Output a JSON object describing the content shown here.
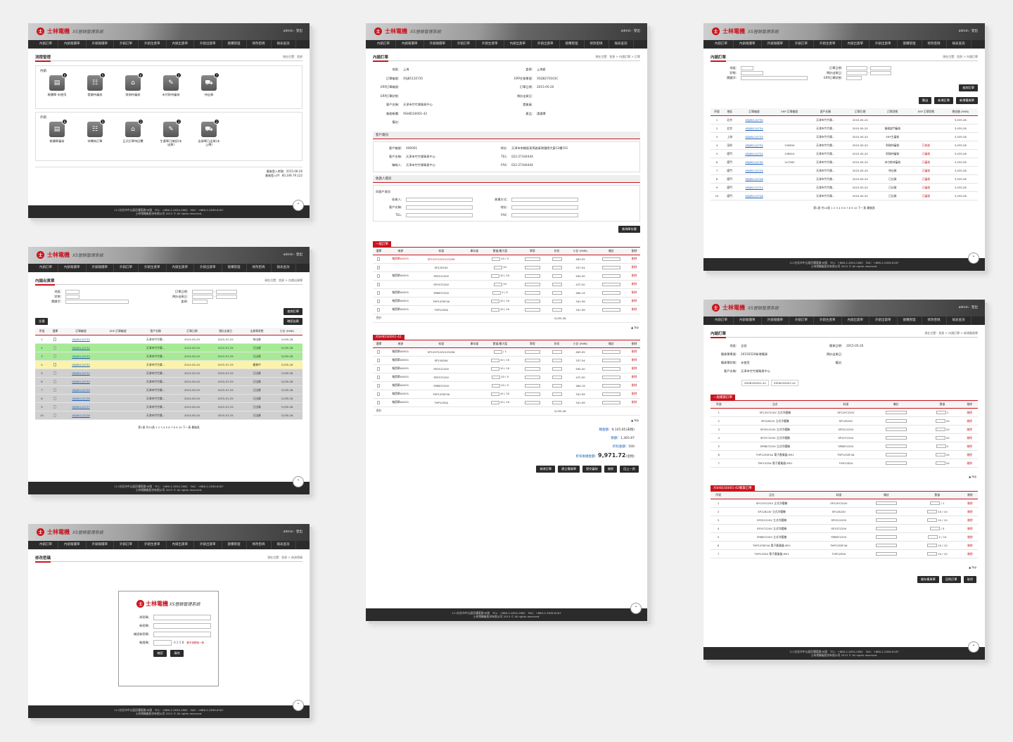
{
  "brand": {
    "logo_mark": "士",
    "logo": "士林電機",
    "system": "XS營銷管理系統",
    "user": "admin · 登出"
  },
  "nav": [
    "內銷訂單",
    "內銷報價單",
    "外銷報價單",
    "外銷訂單",
    "外銷生產單",
    "內銷出貨單",
    "外銷出貨單",
    "搶購管理",
    "修改密碼",
    "報表查詢"
  ],
  "footer": {
    "line1": "111台北市中山區民權東路36號　TEL：+886-2-2834-2662　FAX：+886-2-2836-6187",
    "line2": "士林電機廠股份有限公司 2015 © All rights reserved."
  },
  "p1": {
    "title": "流程管理",
    "crumb": "現在位置：首頁",
    "sec1": "內銷",
    "sec2": "外銷",
    "icons1": [
      {
        "label": "報價單-未使用",
        "badge": "6"
      },
      {
        "label": "營業待審核",
        "badge": "5"
      },
      {
        "label": "財務待審核",
        "badge": "6"
      },
      {
        "label": "未付款待審核",
        "badge": "2"
      },
      {
        "label": "待出貨",
        "badge": "7"
      }
    ],
    "icons2": [
      {
        "label": "報價單審核",
        "badge": "6"
      },
      {
        "label": "待轉為訂單",
        "badge": "5"
      },
      {
        "label": "正式訂單待回覆",
        "badge": "3"
      },
      {
        "label": "生產單已確認(未出貨)",
        "badge": "3"
      },
      {
        "label": "出貨單已出貨(未上傳)",
        "badge": "2"
      }
    ],
    "date": "最後登入時間：2015-06-26",
    "ip": "最後登入IP：60.249.79.122"
  },
  "p2": {
    "title": "內銷出貨單",
    "crumb": "現在位置：首頁 > 內銷出貨單",
    "search_btn": "查詢訂單",
    "all_btn": "全選",
    "confirm_btn": "確認出貨",
    "headers": [
      "序號",
      "選擇",
      "訂單編號",
      "ERP 訂單編號",
      "客戶名稱",
      "訂單日期",
      "預計出貨日",
      "出貨單狀態",
      "小計 (RMB)"
    ],
    "rows": [
      [
        "1",
        "XSJ85110735",
        "天津市竹竹樂...",
        "2015-05-20",
        "2015-07-25",
        "待出貨",
        "3,035.28"
      ],
      [
        "2",
        "XSJ85110734",
        "天津市竹竹樂...",
        "2015-05-20",
        "2015-07-25",
        "已出貨",
        "3,035.28"
      ],
      [
        "3",
        "XSJ85110733",
        "天津市竹竹樂...",
        "2015-05-20",
        "2015-07-25",
        "已出貨",
        "3,035.28"
      ],
      [
        "4",
        "XSJ85110732",
        "天津市竹竹樂...",
        "2015-05-20",
        "2015-07-25",
        "備貨中",
        "3,035.28"
      ],
      [
        "5",
        "XSJ85110731",
        "天津市竹竹樂...",
        "2015-05-20",
        "2015-07-25",
        "已出貨",
        "3,035.28"
      ],
      [
        "6",
        "XSJ85110730",
        "天津市竹竹樂...",
        "2015-05-20",
        "2015-07-25",
        "已出貨",
        "3,035.28"
      ],
      [
        "7",
        "XSJ85110729",
        "天津市竹竹樂...",
        "2015-05-20",
        "2015-07-25",
        "已出貨",
        "3,035.28"
      ],
      [
        "8",
        "XSJ85110728",
        "天津市竹竹樂...",
        "2015-05-20",
        "2015-07-25",
        "已出貨",
        "3,035.28"
      ],
      [
        "9",
        "XSJ85110727",
        "天津市竹竹樂...",
        "2015-05-20",
        "2015-07-25",
        "已出貨",
        "3,035.28"
      ],
      [
        "10",
        "XSJ85110726",
        "天津市竹竹樂...",
        "2015-05-20",
        "2015-07-25",
        "已出貨",
        "3,035.28"
      ]
    ],
    "pager": "第1頁 共10頁 1 2 3 4 5 6 7 8 9 10 下一頁 最後頁"
  },
  "p3": {
    "title": "修改密碼",
    "crumb": "現在位置：首頁 > 修改密碼",
    "fields": [
      "原密碼：",
      "新密碼：",
      "確認新密碼：",
      "驗證碼："
    ],
    "captcha": "A 2 5 B",
    "refresh": "看不清楚換一張",
    "ok": "確認",
    "clear": "清除"
  },
  "p4": {
    "title": "內銷訂單",
    "crumb": "現在位置：首頁 > 內銷訂單 > 訂單",
    "info": [
      [
        "地區：",
        "上海"
      ],
      [
        "訂單編號：",
        "XSJ85110735"
      ],
      [
        "ERP訂單編號：",
        ""
      ],
      [
        "ERP訂單狀態：",
        ""
      ],
      [
        "客戶名稱：",
        "天津市竹竹樂貿易中心"
      ],
      [
        "業務報價：",
        "XSH81S0001-42"
      ],
      [
        "備註：",
        ""
      ]
    ],
    "info2": [
      [
        "倉庫：",
        "上海倉"
      ],
      [
        "ERP交貨單號：",
        "XSQ8270103C"
      ],
      [
        "訂單日期：",
        "2015-05-20"
      ],
      [
        "預計出貨日：",
        ""
      ],
      [
        "營業員：",
        ""
      ],
      [
        "產品：",
        "請選擇"
      ]
    ],
    "cust_title": "客戶資訊",
    "cust": [
      [
        "客戶編號：",
        "A00001"
      ],
      [
        "客戶名稱：",
        "天津市竹竹樂貿易中心"
      ],
      [
        "聯絡人：",
        "天津市竹竹樂貿易中心"
      ]
    ],
    "cust2": [
      [
        "地址：",
        "天津市南開區東馬路泰興國際大廈12樓101"
      ],
      [
        "TEL：",
        "022-27344444"
      ],
      [
        "FAX：",
        "022-27344444"
      ]
    ],
    "recv_title": "收貨人資訊",
    "recv_chk": "同客戶資訊",
    "recv": [
      "收貨人：",
      "客戶名稱：",
      "TEL："
    ],
    "recv2": [
      "貨運方式：",
      "地址：",
      "FAX："
    ],
    "btn_stock": "查詢庫存量",
    "sec1": "一般訂單",
    "sec2": "XSH81S0001-42",
    "headers": [
      "選擇",
      "來源",
      "料號",
      "庫存量",
      "數量/最大值",
      "單價",
      "折扣",
      "小計 (RMB)",
      "備註",
      "刪除"
    ],
    "rows1": [
      [
        "報價單AX001",
        "SP1297220V123456",
        "10 / 3",
        "463.0509",
        "13.1234",
        "463.05",
        "刪除"
      ],
      [
        "",
        "SP12924V",
        "10",
        "337.7545",
        "",
        "337.54",
        "刪除"
      ],
      [
        "報價單AX001",
        "SP2S1220V",
        "10 / 10",
        "59.4009",
        "",
        "594.00",
        "刪除"
      ],
      [
        "",
        "SP1S7220V",
        "10",
        "94.6009",
        "",
        "472.50",
        "刪除"
      ],
      [
        "報價單AX001",
        "SP8B7220V",
        "5 / 5",
        "242.0964",
        "",
        "484.19",
        "刪除"
      ],
      [
        "報價單AX001",
        "THP12S5F4A",
        "10 / 10",
        "34.1991",
        "",
        "341.99",
        "刪除"
      ],
      [
        "報價單AX001",
        "THP12S5A",
        "10 / 10",
        "34.1991",
        "",
        "341.99",
        "刪除"
      ]
    ],
    "rows2": [
      [
        "報價單AX001",
        "SP1297220V123456",
        "/ 1",
        "463.0509",
        "13.1234",
        "463.05",
        "刪除"
      ],
      [
        "報價單AX001",
        "SP1262AV",
        "10 / 10",
        "33.7545",
        "",
        "337.54",
        "刪除"
      ],
      [
        "報價單AX001",
        "SP2S1220V",
        "10 / 10",
        "59.4009",
        "",
        "594.00",
        "刪除"
      ],
      [
        "報價單AX001",
        "SP2S7220V",
        "10 / 5",
        "94.6009",
        "",
        "472.50",
        "刪除"
      ],
      [
        "報價單AX001",
        "SP8B7220V",
        "10 / 5",
        "242.0964",
        "",
        "484.19",
        "刪除"
      ],
      [
        "報價單AX001",
        "THP12S5F4A",
        "10 / 10",
        "34.1991",
        "",
        "341.99",
        "刪除"
      ],
      [
        "報價單AX001",
        "THP12S5A",
        "10 / 10",
        "34.1991",
        "",
        "341.99",
        "刪除"
      ]
    ],
    "total_label": "合計",
    "total": "3,035.28",
    "top": "▲ top",
    "sum": [
      [
        "總金額：",
        "9,105.85(未稅)"
      ],
      [
        "稅額：",
        "1,365.87"
      ],
      [
        "折扣金額：",
        "500"
      ]
    ],
    "grand_label": "折扣後總金額：",
    "grand": "9,971.72",
    "grand_unit": "(含稅)",
    "actions": [
      "修改訂單",
      "建立備貨單",
      "提交審核",
      "刪除",
      "回上一頁"
    ]
  },
  "p5": {
    "title": "內銷訂單",
    "crumb": "現在位置：首頁 > 內銷訂單",
    "btns": [
      "匯出",
      "新增訂單",
      "新增備貨單"
    ],
    "search_btn": "查詢訂單",
    "headers": [
      "序號",
      "地區",
      "訂單編號",
      "ERP 訂單編號",
      "客戶名稱",
      "訂單日期",
      "訂單狀態",
      "ERP 訂單狀態",
      "總金額 (RMB)"
    ],
    "rows": [
      [
        "1",
        "北京",
        "XSJ85110735",
        "",
        "天津市竹竹樂...",
        "2015-05-20",
        "",
        "",
        "3,035.28"
      ],
      [
        "2",
        "北京",
        "XSJ85110734",
        "",
        "天津市竹竹樂...",
        "2015-05-20",
        "業務部門審核",
        "",
        "3,035.28"
      ],
      [
        "3",
        "上海",
        "XSJ85110733",
        "",
        "天津市竹竹樂...",
        "2015-05-20",
        "ERP主審核",
        "",
        "3,035.28"
      ],
      [
        "4",
        "深圳",
        "XSJ85110732",
        "130834",
        "天津市竹竹樂...",
        "2015-05-20",
        "財務待審核",
        "已核准",
        "3,035.28"
      ],
      [
        "5",
        "廈門",
        "XSJ85110731",
        "138924",
        "天津市竹竹樂...",
        "2015-05-20",
        "財務待審核",
        "已審核",
        "3,035.28"
      ],
      [
        "6",
        "廈門",
        "XSJ85110730",
        "147262",
        "天津市竹竹樂...",
        "2015-05-20",
        "未付款待審核",
        "已審核",
        "3,035.28"
      ],
      [
        "7",
        "廈門",
        "XSJ85110729",
        "",
        "天津市竹竹樂...",
        "2015-05-20",
        "待出貨",
        "已審核",
        "3,035.28"
      ],
      [
        "8",
        "廈門",
        "XSJ85110728",
        "",
        "天津市竹竹樂...",
        "2015-05-20",
        "已出貨",
        "已審核",
        "3,035.28"
      ],
      [
        "9",
        "廈門",
        "XSJ85110727",
        "",
        "天津市竹竹樂...",
        "2015-05-20",
        "已出貨",
        "已審核",
        "3,035.28"
      ],
      [
        "10",
        "廈門",
        "XSJ85110726",
        "",
        "天津市竹竹樂...",
        "2015-05-20",
        "已出貨",
        "已審核",
        "3,035.28"
      ]
    ],
    "pager": "第1頁 共10頁 1 2 3 4 5 6 7 8 9 10 下一頁 最後頁"
  },
  "p6": {
    "title": "內銷訂單",
    "crumb": "現在位置：首頁 > 內銷訂單 > 新增備貨單",
    "info": [
      [
        "地區：",
        "全部"
      ],
      [
        "備貨單單號：",
        "20150520新增備貨"
      ],
      [
        "備貨單狀態：",
        "未使用"
      ],
      [
        "客戶名稱：",
        "天津市竹竹樂貿易中心"
      ]
    ],
    "info2": [
      [
        "備貨日期：",
        "2015-05-20"
      ],
      [
        "預計出貨日：",
        ""
      ],
      [
        "備註：",
        ""
      ]
    ],
    "tags": [
      "XSH81S0001-42",
      "XSH81S0002-42"
    ],
    "sec1": "一般備貨訂單",
    "sec2": "XSH81S0001-42備貨訂單",
    "headers": [
      "序號",
      "品名",
      "料號",
      "備註",
      "數量",
      "刪除"
    ],
    "rows1": [
      [
        "1",
        "SP1297220V 立式冷暖機",
        "SP1297220V",
        "1",
        "刪除"
      ],
      [
        "2",
        "SP12624V 立式冷暖機",
        "SP12624V",
        "10",
        "刪除"
      ],
      [
        "3",
        "SP2S1220V 立式冷暖機",
        "SP2S1220V",
        "10",
        "刪除"
      ],
      [
        "4",
        "SP1S7220V 立式冷暖機",
        "SP1S7220V",
        "10",
        "刪除"
      ],
      [
        "5",
        "SP8B7220V 立式冷暖機",
        "SP8B7220V",
        "2",
        "刪除"
      ],
      [
        "6",
        "THP12S5F4A 電子產業器-M51",
        "THP12S5F4A",
        "10",
        "刪除"
      ],
      [
        "7",
        "THP12S5A 電子產業器-M51",
        "THP12S5A",
        "10",
        "刪除"
      ]
    ],
    "rows2": [
      [
        "1",
        "SP1297220V 立式冷暖機",
        "SP1297220V",
        "/ 1",
        "刪除"
      ],
      [
        "2",
        "SP12624V 立式冷暖機",
        "SP12624V",
        "10 / 10",
        "刪除"
      ],
      [
        "3",
        "SP2S1220V 立式冷暖機",
        "SP2S1220V",
        "10 / 10",
        "刪除"
      ],
      [
        "4",
        "SP1S7220V 立式冷暖機",
        "SP1S7220V",
        "/ 5",
        "刪除"
      ],
      [
        "5",
        "SP8B7220V 立式冷暖機",
        "SP8B7220V",
        "2 / 10",
        "刪除"
      ],
      [
        "6",
        "THP12S5F4A 電子產業器-M51",
        "THP12S5F4A",
        "10 / 10",
        "刪除"
      ],
      [
        "7",
        "THP12S5A 電子產業器-M51",
        "THP12S5A",
        "10 / 10",
        "刪除"
      ]
    ],
    "actions": [
      "儲存備貨單",
      "回到訂單",
      "取消"
    ]
  }
}
